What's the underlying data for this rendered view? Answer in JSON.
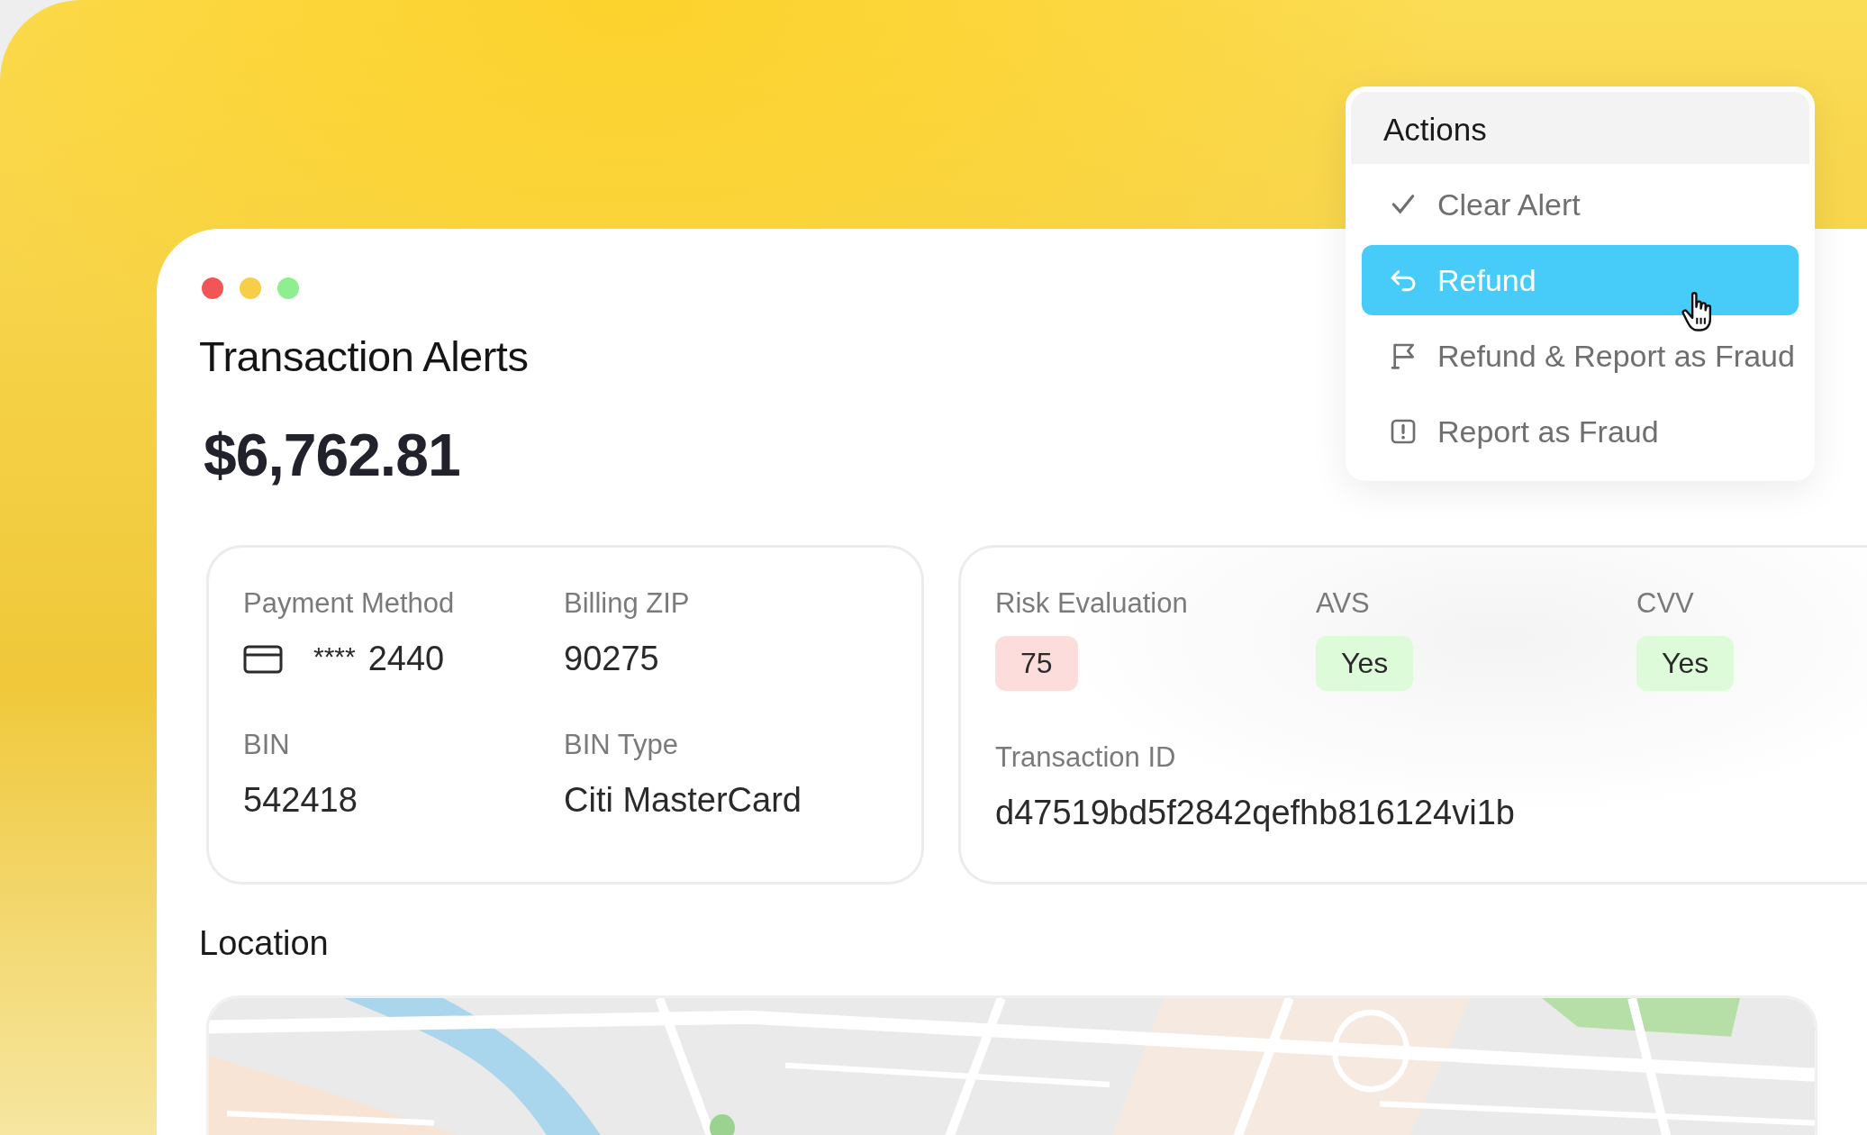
{
  "window": {
    "title": "Transaction Alerts"
  },
  "amount": "$6,762.81",
  "payment_card": {
    "fields": [
      {
        "label": "Payment Method",
        "value": "2440",
        "masked": "****",
        "kind": "card"
      },
      {
        "label": "Billing ZIP",
        "value": "90275",
        "kind": "text"
      },
      {
        "label": "BIN",
        "value": "542418",
        "kind": "text"
      },
      {
        "label": "BIN Type",
        "value": "Citi MasterCard",
        "kind": "text"
      }
    ]
  },
  "risk_card": {
    "checks": [
      {
        "label": "Risk Evaluation",
        "value": "75",
        "kind": "alert"
      },
      {
        "label": "AVS",
        "value": "Yes",
        "kind": "ok"
      },
      {
        "label": "CVV",
        "value": "Yes",
        "kind": "ok"
      }
    ],
    "transaction_id": {
      "label": "Transaction ID",
      "value": "d47519bd5f2842qefhb816124vi1b"
    }
  },
  "location": {
    "title": "Location"
  },
  "actions_menu": {
    "title": "Actions",
    "items": [
      {
        "label": "Clear Alert",
        "kind": "clear",
        "selected": false
      },
      {
        "label": "Refund",
        "kind": "refund",
        "selected": true
      },
      {
        "label": "Refund & Report as Fraud",
        "kind": "refund_report",
        "selected": false
      },
      {
        "label": "Report as Fraud",
        "kind": "report",
        "selected": false
      }
    ]
  }
}
